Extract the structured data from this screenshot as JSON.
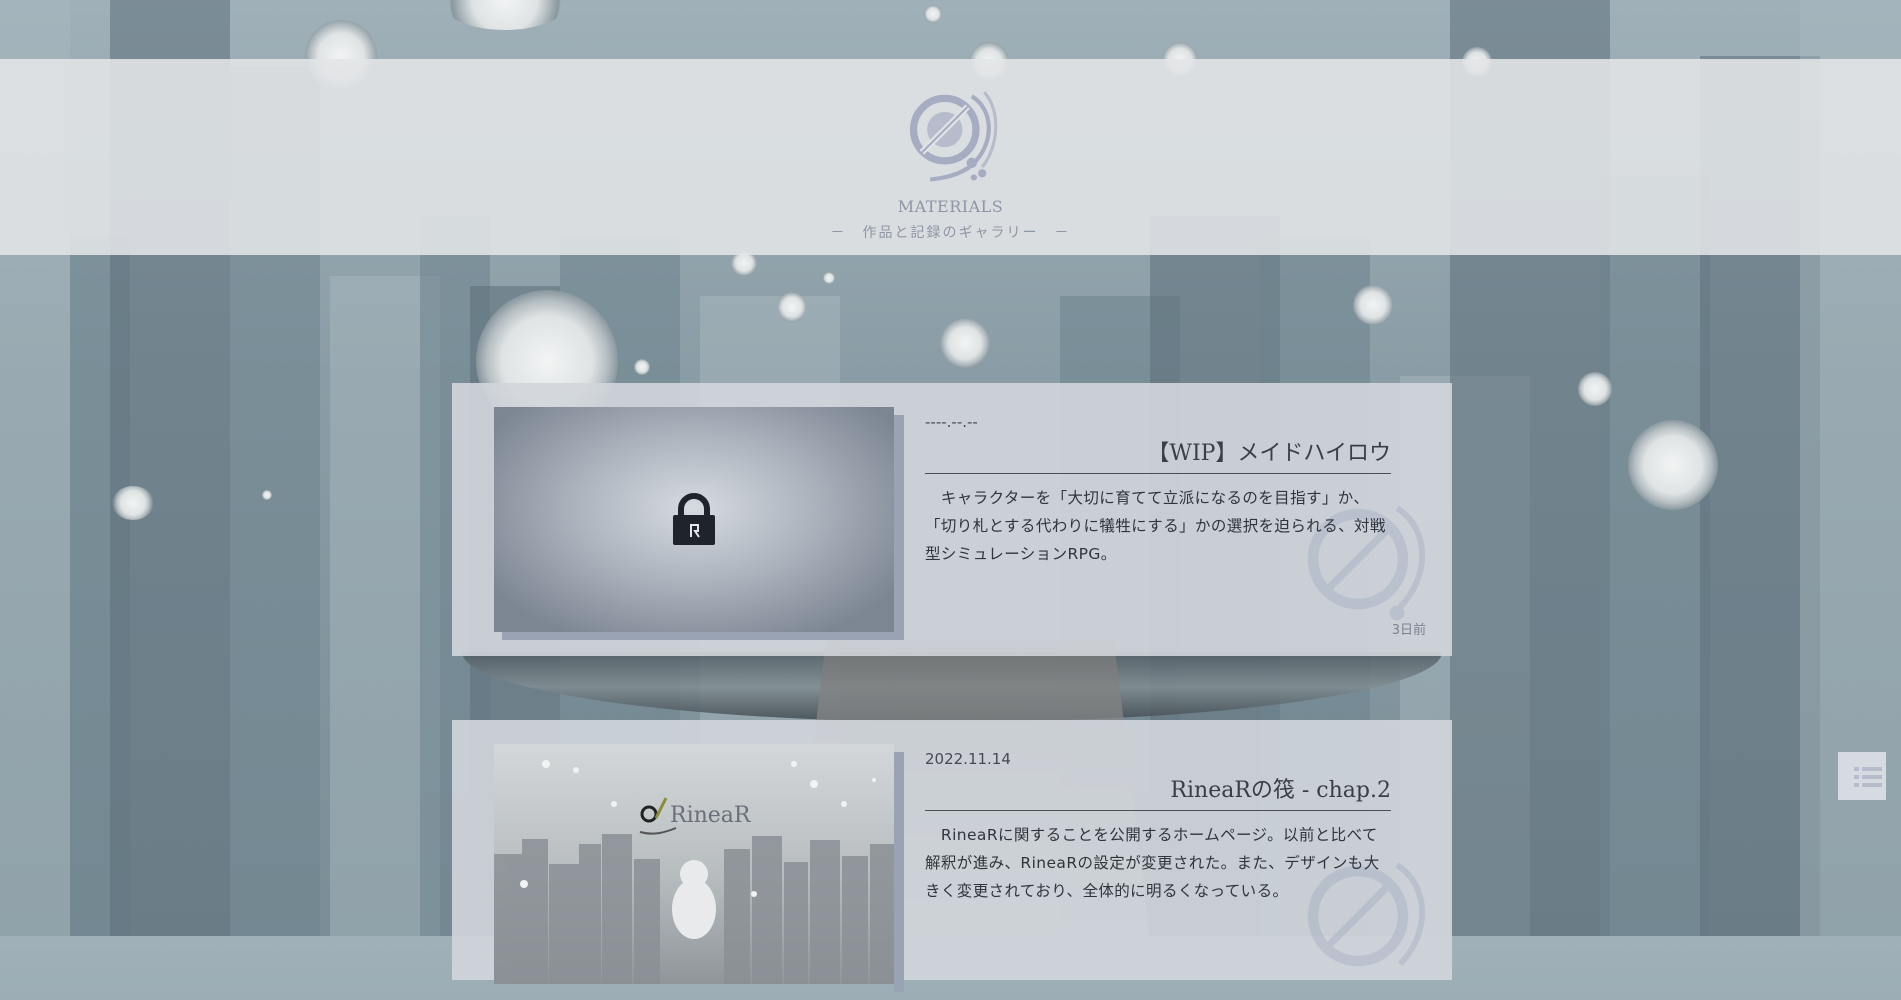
{
  "site": {
    "title": "MATERIALS",
    "subtitle": "－　作品と記録のギャラリー　－"
  },
  "posts": [
    {
      "date": "----.--.--",
      "title": "【WIP】メイドハイロウ",
      "excerpt": "　キャラクターを「大切に育てて立派になるのを目指す」か、「切り札とする代わりに犠牲にする」かの選択を迫られる、対戦型シミュレーションRPG。",
      "age": "3日前",
      "thumbnail_icon": "lock-icon"
    },
    {
      "date": "2022.11.14",
      "title": "RineaRの筏 - chap.2",
      "excerpt": "　RineaRに関することを公開するホームページ。以前と比べて解釈が進み、RineaRの設定が変更された。また、デザインも大きく変更されており、全体的に明るくなっている。",
      "thumbnail_text": "RineaR"
    }
  ],
  "menu": {
    "icon": "list-icon"
  },
  "colors": {
    "background": "#8a9ca5",
    "header_band": "#e2e5e7",
    "card": "#d2d6db",
    "accent": "#8d96a6",
    "text": "#2f353c"
  }
}
